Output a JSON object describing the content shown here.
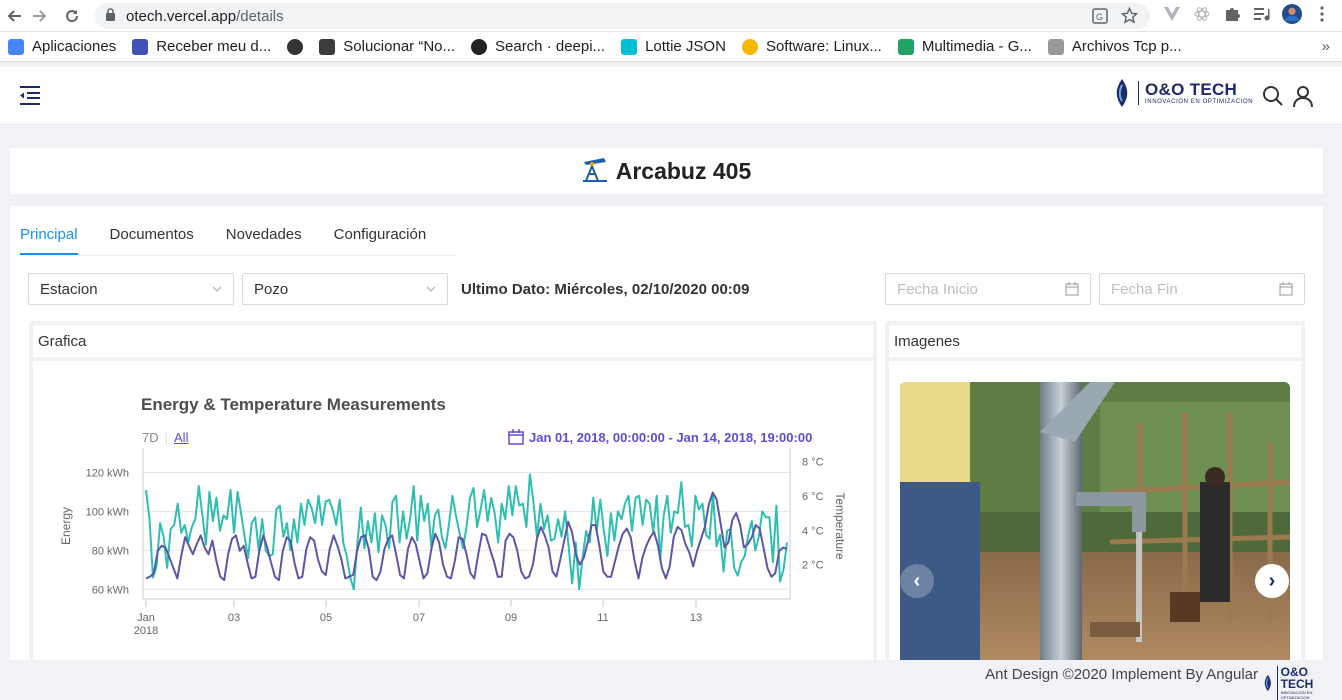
{
  "browser": {
    "url_host": "otech.vercel.app",
    "url_path": "/details",
    "bookmarks": [
      {
        "label": "Aplicaciones",
        "icon": "apps-grid-icon",
        "color": "#4285f4"
      },
      {
        "label": "Receber meu d...",
        "icon": "bookmark-k-icon",
        "color": "#3f51b5"
      },
      {
        "label": "",
        "icon": "globe-icon",
        "color": "#333333"
      },
      {
        "label": "Solucionar “No...",
        "icon": "bookmark-dark-icon",
        "color": "#3c3c3c"
      },
      {
        "label": "Search · deepi...",
        "icon": "github-icon",
        "color": "#222222"
      },
      {
        "label": "Lottie JSON",
        "icon": "lottie-icon",
        "color": "#00c1d4"
      },
      {
        "label": "Software: Linux...",
        "icon": "medal-icon",
        "color": "#f5b800"
      },
      {
        "label": "Multimedia - G...",
        "icon": "google-drive-icon",
        "color": "#1fa463"
      },
      {
        "label": "Archivos Tcp p...",
        "icon": "page-icon",
        "color": "#999999"
      }
    ]
  },
  "header": {
    "logo_title": "O&O TECH",
    "logo_subtitle": "INNOVACION EN OPTIMIZACION",
    "brand_color": "#1d2a6b"
  },
  "page": {
    "title": "Arcabuz 405"
  },
  "tabs": [
    {
      "label": "Principal",
      "active": true
    },
    {
      "label": "Documentos",
      "active": false
    },
    {
      "label": "Novedades",
      "active": false
    },
    {
      "label": "Configuración",
      "active": false
    }
  ],
  "filters": {
    "station": "Estacion",
    "well": "Pozo",
    "last_data": "Ultimo Dato: Miércoles, 02/10/2020 00:09",
    "start_placeholder": "Fecha Inicio",
    "end_placeholder": "Fecha Fin"
  },
  "panels": {
    "chart_header": "Grafica",
    "images_header": "Imagenes"
  },
  "chart_controls": {
    "range_7d": "7D",
    "range_all": "All",
    "date_range": "Jan 01, 2018, 00:00:00 - Jan 14, 2018, 19:00:00"
  },
  "chart_data": {
    "type": "line",
    "title": "Energy & Temperature Measurements",
    "ylabel": "Energy",
    "y2label": "Temperature",
    "ylim": [
      55,
      130
    ],
    "y2lim": [
      0,
      8.5
    ],
    "yticks": [
      "60 kWh",
      "80 kWh",
      "100 kWh",
      "120 kWh"
    ],
    "y2ticks": [
      "2 °C",
      "4 °C",
      "6 °C",
      "8 °C"
    ],
    "xticks": [
      "Jan\n2018",
      "03",
      "05",
      "07",
      "09",
      "11",
      "13"
    ],
    "grid": true,
    "series": [
      {
        "axis": "y",
        "color": "#2ebfb0",
        "values": [
          111,
          96,
          66,
          72,
          94,
          87,
          71,
          91,
          93,
          104,
          89,
          93,
          84,
          92,
          96,
          113,
          98,
          83,
          110,
          95,
          107,
          90,
          98,
          96,
          111,
          89,
          110,
          99,
          87,
          76,
          94,
          97,
          80,
          96,
          80,
          77,
          78,
          101,
          103,
          87,
          94,
          80,
          96,
          84,
          104,
          93,
          106,
          102,
          94,
          108,
          93,
          105,
          106,
          101,
          93,
          106,
          84,
          77,
          66,
          60,
          83,
          102,
          81,
          95,
          84,
          99,
          79,
          98,
          93,
          81,
          105,
          108,
          84,
          100,
          86,
          96,
          113,
          85,
          108,
          95,
          104,
          82,
          98,
          101,
          87,
          81,
          93,
          108,
          98,
          89,
          81,
          92,
          107,
          112,
          92,
          101,
          111,
          95,
          107,
          99,
          84,
          104,
          96,
          113,
          98,
          113,
          103,
          104,
          92,
          119,
          105,
          87,
          104,
          91,
          98,
          85,
          86,
          96,
          87,
          100,
          82,
          63,
          84,
          60,
          77,
          90,
          84,
          107,
          90,
          106,
          90,
          77,
          99,
          85,
          100,
          96,
          104,
          108,
          90,
          107,
          108,
          93,
          106,
          104,
          89,
          108,
          75,
          98,
          108,
          89,
          100,
          99,
          115,
          92,
          93,
          82,
          108,
          101,
          104,
          88,
          86,
          109,
          82,
          88,
          69,
          90,
          91,
          71,
          67,
          74,
          77,
          88,
          95,
          80,
          87,
          100,
          97,
          97,
          74,
          103,
          64,
          70,
          84
        ]
      },
      {
        "axis": "y2",
        "color": "#5b57a8",
        "values": [
          1.2,
          1.3,
          1.5,
          2.8,
          3.1,
          3.0,
          2.4,
          1.8,
          1.2,
          2.5,
          3.6,
          3.1,
          2.6,
          3.2,
          3.7,
          3.0,
          2.6,
          3.4,
          2.2,
          1.3,
          1.1,
          2.6,
          3.5,
          3.7,
          2.8,
          3.1,
          2.1,
          1.2,
          1.3,
          2.8,
          3.7,
          3.0,
          2.1,
          1.3,
          1.1,
          2.8,
          3.6,
          3.4,
          2.1,
          1.2,
          1.3,
          2.9,
          3.6,
          3.4,
          2.3,
          1.6,
          1.4,
          2.9,
          3.7,
          3.1,
          2.3,
          1.2,
          1.3,
          1.4,
          2.8,
          3.6,
          3.7,
          2.9,
          1.3,
          1.1,
          1.6,
          2.9,
          3.5,
          3.7,
          2.6,
          1.4,
          1.2,
          2.9,
          3.6,
          3.2,
          2.2,
          1.2,
          1.5,
          2.9,
          3.8,
          3.3,
          2.0,
          1.3,
          1.2,
          2.2,
          3.6,
          3.5,
          2.6,
          1.5,
          1.2,
          2.6,
          3.8,
          3.7,
          2.9,
          2.2,
          1.3,
          1.3,
          3.4,
          3.8,
          3.6,
          2.8,
          1.6,
          1.2,
          1.3,
          2.0,
          3.5,
          4.2,
          3.7,
          3.0,
          1.6,
          1.3,
          2.3,
          3.4,
          4.5,
          3.9,
          2.6,
          2.0,
          2.4,
          3.3,
          4.3,
          4.3,
          3.1,
          1.6,
          1.3,
          1.3,
          2.2,
          3.1,
          3.8,
          4.1,
          3.6,
          2.2,
          1.2,
          2.4,
          3.1,
          3.6,
          3.9,
          3.1,
          1.8,
          1.2,
          1.9,
          3.6,
          4.2,
          4.0,
          3.2,
          2.7,
          1.9,
          2.8,
          3.5,
          4.2,
          5.5,
          6.2,
          5.8,
          4.4,
          3.0,
          3.3,
          4.6,
          5.0,
          4.3,
          3.0,
          3.2,
          3.6,
          4.3,
          4.1,
          3.0,
          1.8,
          1.3,
          1.5,
          2.8,
          3.0,
          2.9
        ]
      }
    ]
  }
}
